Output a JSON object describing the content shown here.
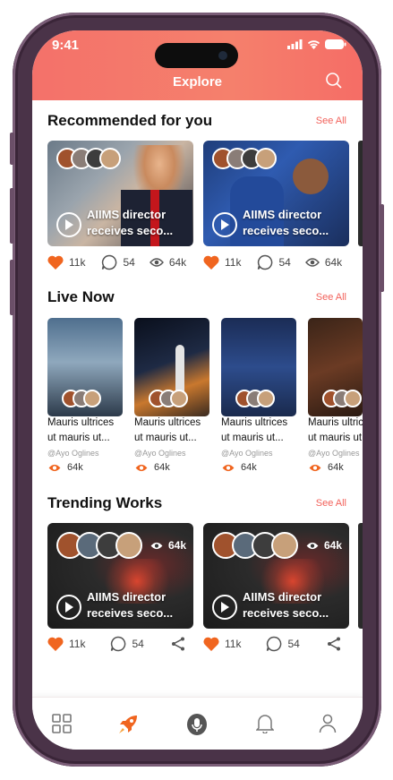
{
  "status": {
    "time": "9:41"
  },
  "header": {
    "title": "Explore"
  },
  "sections": {
    "recommended": {
      "title": "Recommended for you",
      "see_all": "See All",
      "cards": [
        {
          "line1": "AIIMS director",
          "line2": "receives seco...",
          "likes": "11k",
          "comments": "54",
          "views": "64k"
        },
        {
          "line1": "AIIMS director",
          "line2": "receives seco...",
          "likes": "11k",
          "comments": "54",
          "views": "64k"
        }
      ]
    },
    "live": {
      "title": "Live Now",
      "see_all": "See All",
      "cards": [
        {
          "line1": "Mauris ultrices",
          "line2": "ut mauris ut...",
          "user": "@Ayo Oglines",
          "views": "64k"
        },
        {
          "line1": "Mauris ultrices",
          "line2": "ut mauris ut...",
          "user": "@Ayo Oglines",
          "views": "64k"
        },
        {
          "line1": "Mauris ultrices",
          "line2": "ut mauris ut...",
          "user": "@Ayo Oglines",
          "views": "64k"
        },
        {
          "line1": "Mauris ultrices",
          "line2": "ut mauris ut...",
          "user": "@Ayo Oglines",
          "views": "64k"
        }
      ]
    },
    "trending": {
      "title": "Trending Works",
      "see_all": "See All",
      "cards": [
        {
          "line1": "AIIMS director",
          "line2": "receives seco...",
          "views": "64k",
          "likes": "11k",
          "comments": "54"
        },
        {
          "line1": "AIIMS director",
          "line2": "receives seco...",
          "views": "64k",
          "likes": "11k",
          "comments": "54"
        }
      ]
    }
  },
  "navbar": {
    "items": [
      "grid-icon",
      "rocket-icon",
      "microphone-icon",
      "bell-icon",
      "profile-icon"
    ],
    "active": "rocket-icon"
  },
  "colors": {
    "accent": "#f2625b",
    "heart": "#f0651f",
    "frame": "#4a3348"
  }
}
